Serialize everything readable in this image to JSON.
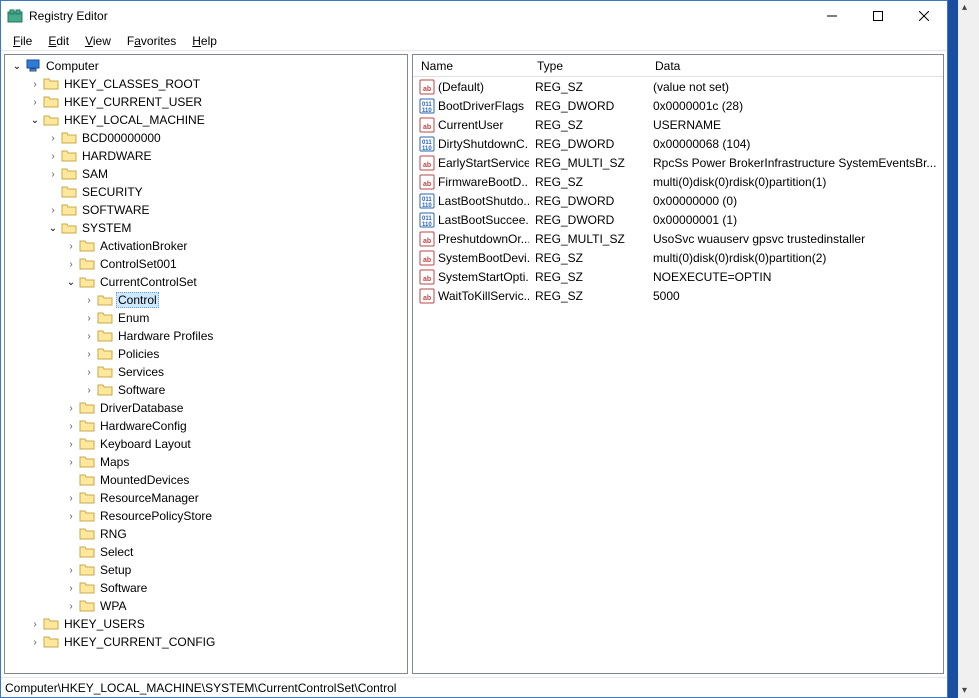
{
  "window": {
    "title": "Registry Editor"
  },
  "menu": {
    "file": "File",
    "edit": "Edit",
    "view": "View",
    "favorites": "Favorites",
    "help": "Help"
  },
  "tree": {
    "root": "Computer",
    "hkcr": "HKEY_CLASSES_ROOT",
    "hkcu": "HKEY_CURRENT_USER",
    "hklm": "HKEY_LOCAL_MACHINE",
    "hklm_children": {
      "bcd": "BCD00000000",
      "hardware": "HARDWARE",
      "sam": "SAM",
      "security": "SECURITY",
      "software": "SOFTWARE",
      "system": "SYSTEM"
    },
    "system_children": {
      "activationbroker": "ActivationBroker",
      "controlset001": "ControlSet001",
      "currentcontrolset": "CurrentControlSet",
      "driverdatabase": "DriverDatabase",
      "hardwareconfig": "HardwareConfig",
      "keyboardlayout": "Keyboard Layout",
      "maps": "Maps",
      "mounteddevices": "MountedDevices",
      "resourcemanager": "ResourceManager",
      "resourcepolicystore": "ResourcePolicyStore",
      "rng": "RNG",
      "select": "Select",
      "setup": "Setup",
      "software2": "Software",
      "wpa": "WPA"
    },
    "ccs_children": {
      "control": "Control",
      "enum": "Enum",
      "hardwareprofiles": "Hardware Profiles",
      "policies": "Policies",
      "services": "Services",
      "software3": "Software"
    },
    "hku": "HKEY_USERS",
    "hkcc": "HKEY_CURRENT_CONFIG"
  },
  "list": {
    "headers": {
      "name": "Name",
      "type": "Type",
      "data": "Data"
    },
    "rows": [
      {
        "icon": "str",
        "name": "(Default)",
        "type": "REG_SZ",
        "data": "(value not set)"
      },
      {
        "icon": "bin",
        "name": "BootDriverFlags",
        "type": "REG_DWORD",
        "data": "0x0000001c (28)"
      },
      {
        "icon": "str",
        "name": "CurrentUser",
        "type": "REG_SZ",
        "data": "USERNAME"
      },
      {
        "icon": "bin",
        "name": "DirtyShutdownC...",
        "type": "REG_DWORD",
        "data": "0x00000068 (104)"
      },
      {
        "icon": "str",
        "name": "EarlyStartServices",
        "type": "REG_MULTI_SZ",
        "data": "RpcSs Power BrokerInfrastructure SystemEventsBr..."
      },
      {
        "icon": "str",
        "name": "FirmwareBootD...",
        "type": "REG_SZ",
        "data": "multi(0)disk(0)rdisk(0)partition(1)"
      },
      {
        "icon": "bin",
        "name": "LastBootShutdo...",
        "type": "REG_DWORD",
        "data": "0x00000000 (0)"
      },
      {
        "icon": "bin",
        "name": "LastBootSuccee...",
        "type": "REG_DWORD",
        "data": "0x00000001 (1)"
      },
      {
        "icon": "str",
        "name": "PreshutdownOr...",
        "type": "REG_MULTI_SZ",
        "data": "UsoSvc wuauserv gpsvc trustedinstaller"
      },
      {
        "icon": "str",
        "name": "SystemBootDevi...",
        "type": "REG_SZ",
        "data": "multi(0)disk(0)rdisk(0)partition(2)"
      },
      {
        "icon": "str",
        "name": "SystemStartOpti...",
        "type": "REG_SZ",
        "data": " NOEXECUTE=OPTIN"
      },
      {
        "icon": "str",
        "name": "WaitToKillServic...",
        "type": "REG_SZ",
        "data": "5000"
      }
    ]
  },
  "statusbar": {
    "path": "Computer\\HKEY_LOCAL_MACHINE\\SYSTEM\\CurrentControlSet\\Control"
  }
}
